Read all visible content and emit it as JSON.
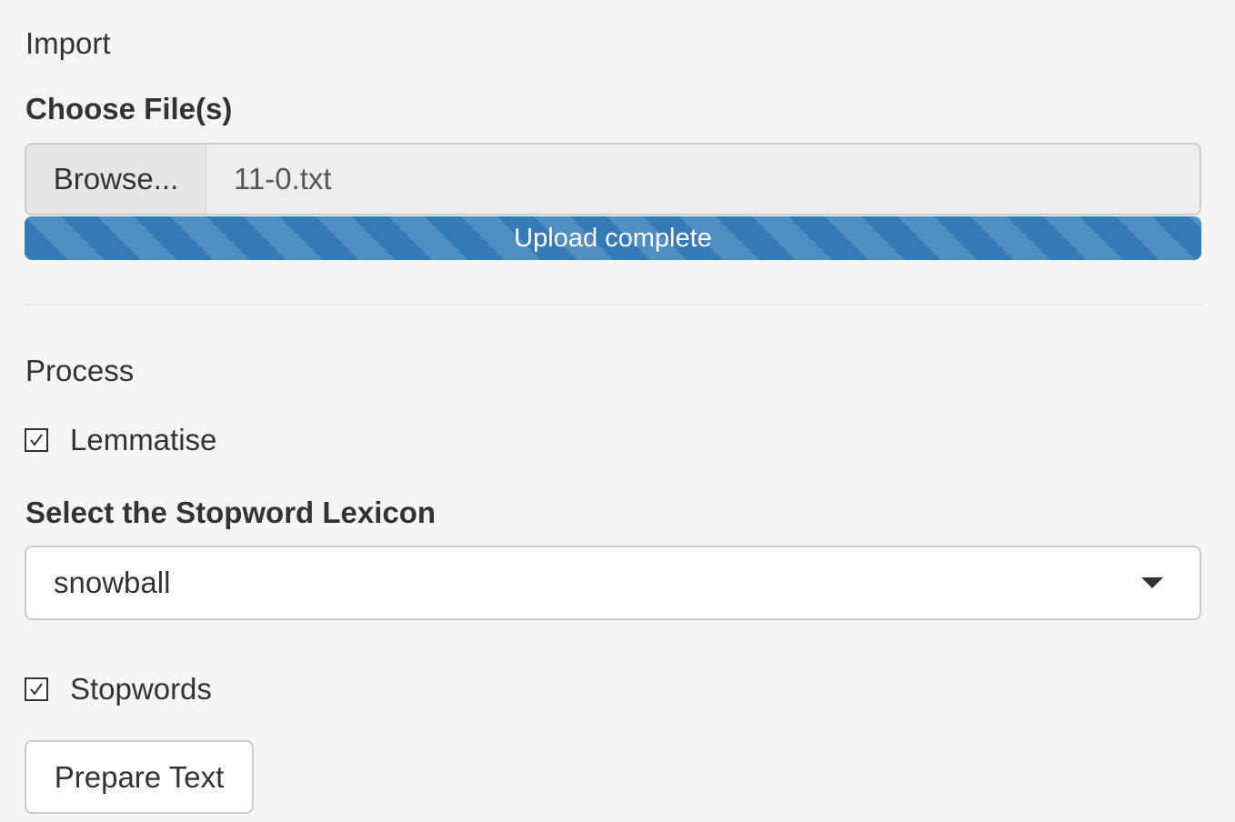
{
  "import": {
    "title": "Import",
    "file_label": "Choose File(s)",
    "browse_label": "Browse...",
    "file_name": "11-0.txt",
    "upload_status": "Upload complete",
    "upload_progress": 1.0
  },
  "process": {
    "title": "Process",
    "lemmatise": {
      "label": "Lemmatise",
      "checked": true
    },
    "stopword_lexicon": {
      "label": "Select the Stopword Lexicon",
      "selected": "snowball"
    },
    "stopwords": {
      "label": "Stopwords",
      "checked": true
    },
    "prepare_button": "Prepare Text"
  },
  "colors": {
    "background": "#f5f5f5",
    "progress": "#337ab7",
    "text": "#333333",
    "border": "#cccccc"
  }
}
